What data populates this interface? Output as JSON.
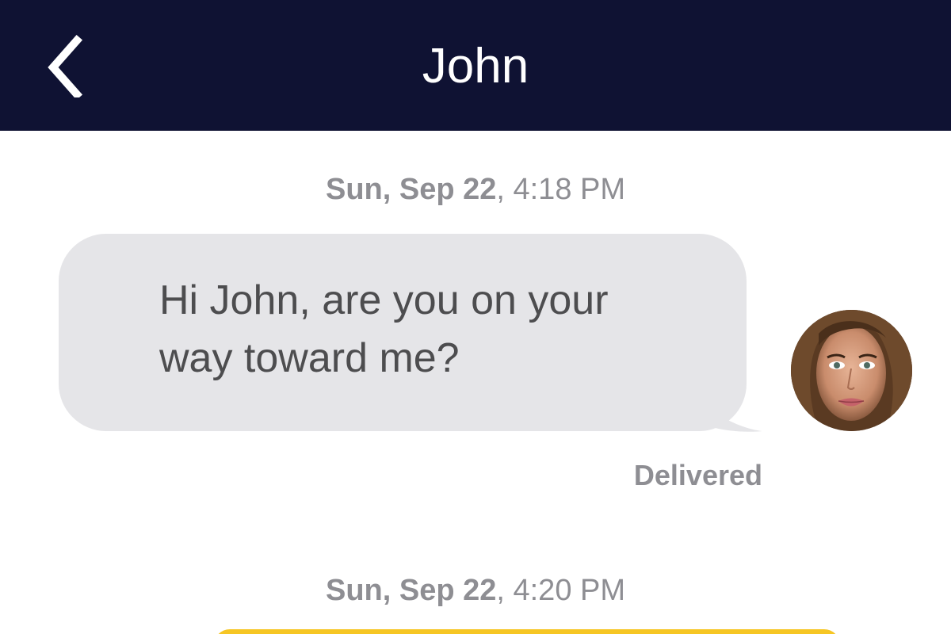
{
  "header": {
    "title": "John",
    "back_icon": "chevron-left-icon",
    "background_color": "#0f1233"
  },
  "messages": [
    {
      "timestamp_date": "Sun, Sep 22",
      "timestamp_time": ", 4:18 PM",
      "text": "Hi John, are you on your way toward me?",
      "status": "Delivered",
      "bubble_color": "#e5e5e8"
    },
    {
      "timestamp_date": "Sun, Sep 22",
      "timestamp_time": ", 4:20 PM",
      "bubble_color": "#f6c624"
    }
  ]
}
